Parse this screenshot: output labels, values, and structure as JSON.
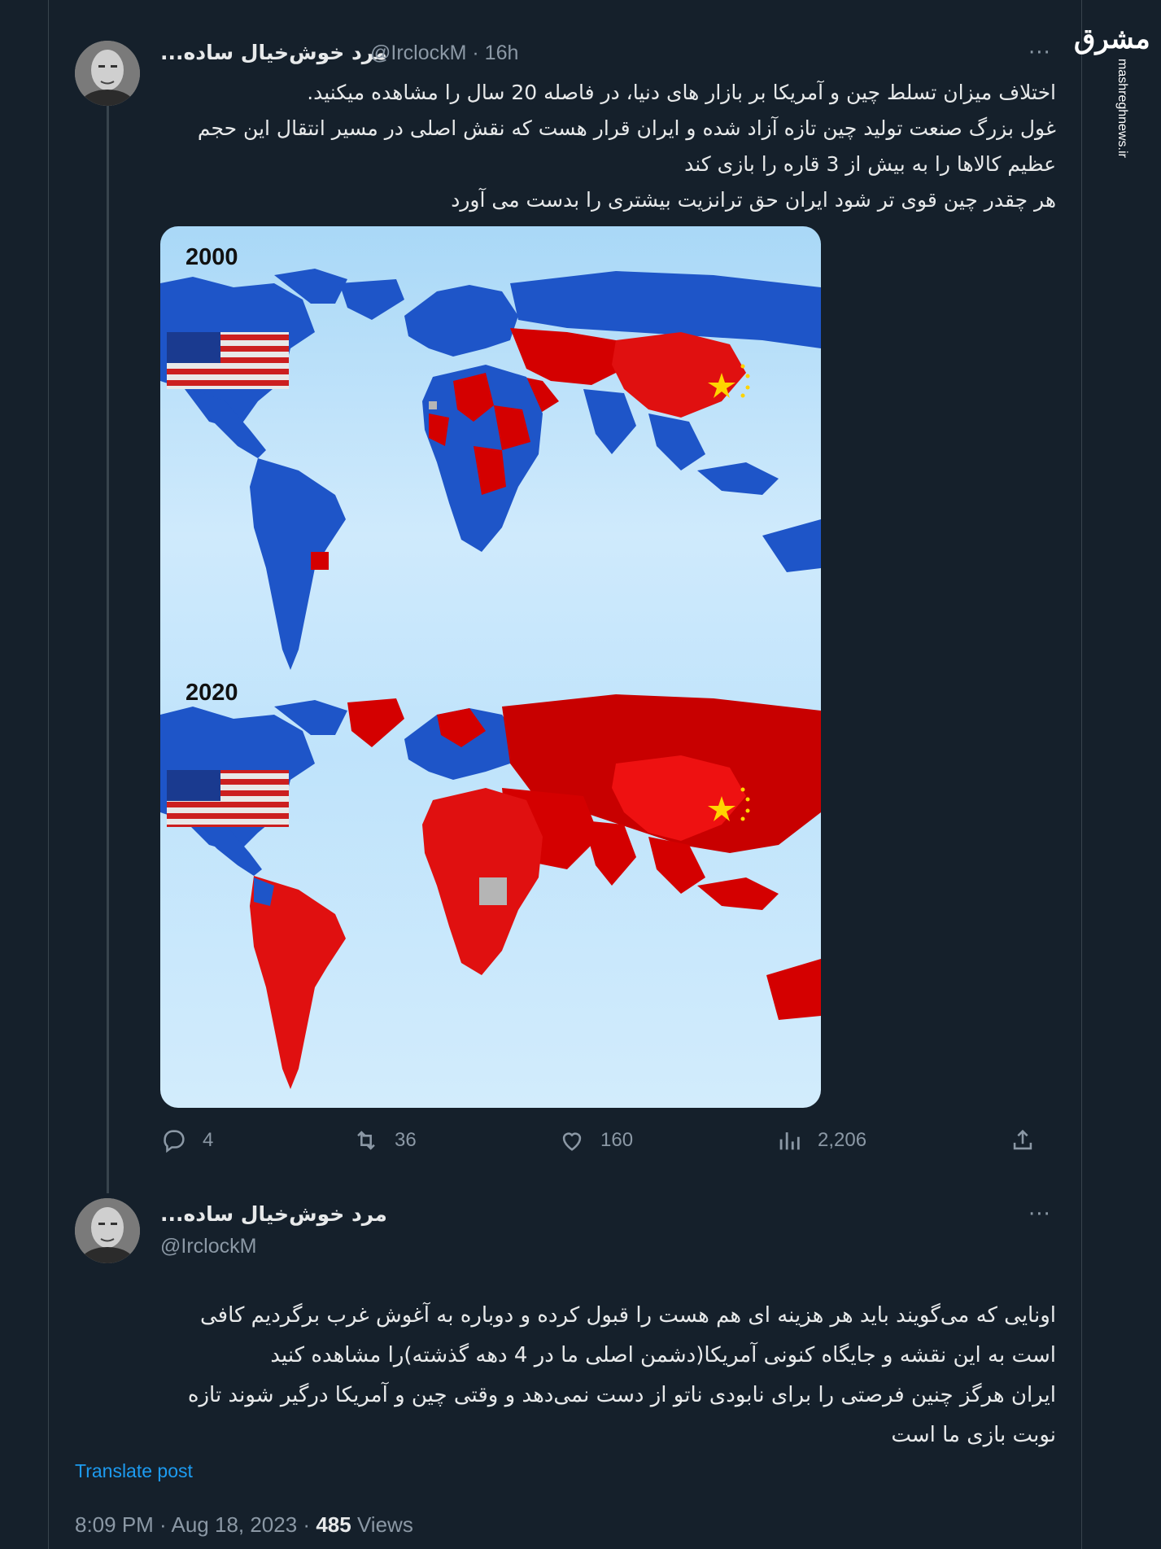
{
  "watermark": {
    "logo": "مشرق",
    "site": "mashreghnews.ir"
  },
  "post1": {
    "author_name": "...مرد خوش‌خیال ساده",
    "handle": "@IrclockM",
    "separator": "·",
    "time": "16h",
    "more_label": "···",
    "text_lines": [
      "اختلاف میزان تسلط چین و آمریکا بر بازار های دنیا، در فاصله 20 سال را مشاهده میکنید.",
      "غول بزرگ صنعت تولید چین تازه آزاد شده و ایران قرار هست که نقش اصلی در مسیر انتقال این حجم",
      "عظیم کالاها را به بیش از 3 قاره را بازی کند",
      "هر چقدر چین قوی تر شود ایران حق ترانزیت بیشتری را بدست می آورد"
    ],
    "image": {
      "year_top": "2000",
      "year_bottom": "2020",
      "colors": {
        "china": "#d40000",
        "usa": "#1e55c8",
        "ocean": "#c6e6fb",
        "neutral": "#b5b5b5"
      }
    },
    "actions": {
      "replies": "4",
      "reposts": "36",
      "likes": "160",
      "views": "2,206"
    }
  },
  "post2": {
    "author_name": "...مرد خوش‌خیال ساده",
    "handle": "@IrclockM",
    "more_label": "···",
    "text_lines": [
      "اونایی که می‌گویند باید هر هزینه ای هم هست را قبول کرده و دوباره به آغوش غرب برگردیم کافی",
      "است به این نقشه و جایگاه کنونی آمریکا(دشمن اصلی ما در 4 دهه گذشته)را مشاهده کنید",
      "ایران هرگز چنین فرصتی را برای نابودی ناتو از دست نمی‌دهد و وقتی چین و آمریکا درگیر شوند تازه",
      "نوبت بازی ما است"
    ],
    "translate_label": "Translate post",
    "timestamp": "8:09 PM · Aug 18, 2023 ·",
    "views_count": "485",
    "views_label": "Views"
  }
}
